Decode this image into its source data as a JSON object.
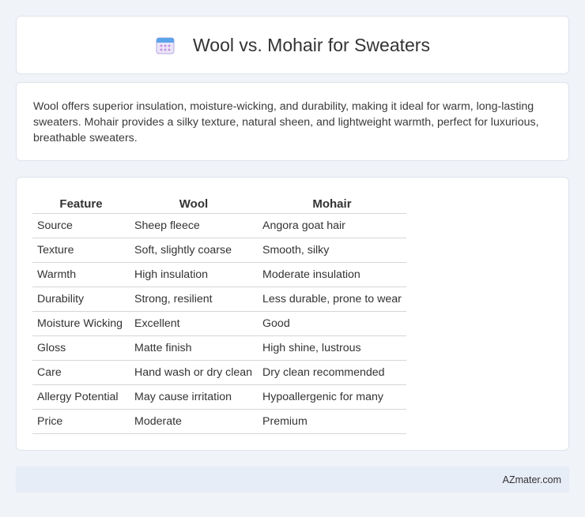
{
  "header": {
    "title": "Wool vs. Mohair for Sweaters",
    "icon": "calendar-icon"
  },
  "summary": {
    "text": "Wool offers superior insulation, moisture-wicking, and durability, making it ideal for warm, long-lasting sweaters. Mohair provides a silky texture, natural sheen, and lightweight warmth, perfect for luxurious, breathable sweaters."
  },
  "table": {
    "headers": [
      "Feature",
      "Wool",
      "Mohair"
    ],
    "rows": [
      [
        "Source",
        "Sheep fleece",
        "Angora goat hair"
      ],
      [
        "Texture",
        "Soft, slightly coarse",
        "Smooth, silky"
      ],
      [
        "Warmth",
        "High insulation",
        "Moderate insulation"
      ],
      [
        "Durability",
        "Strong, resilient",
        "Less durable, prone to wear"
      ],
      [
        "Moisture Wicking",
        "Excellent",
        "Good"
      ],
      [
        "Gloss",
        "Matte finish",
        "High shine, lustrous"
      ],
      [
        "Care",
        "Hand wash or dry clean",
        "Dry clean recommended"
      ],
      [
        "Allergy Potential",
        "May cause irritation",
        "Hypoallergenic for many"
      ],
      [
        "Price",
        "Moderate",
        "Premium"
      ]
    ]
  },
  "footer": {
    "text": "AZmater.com"
  }
}
